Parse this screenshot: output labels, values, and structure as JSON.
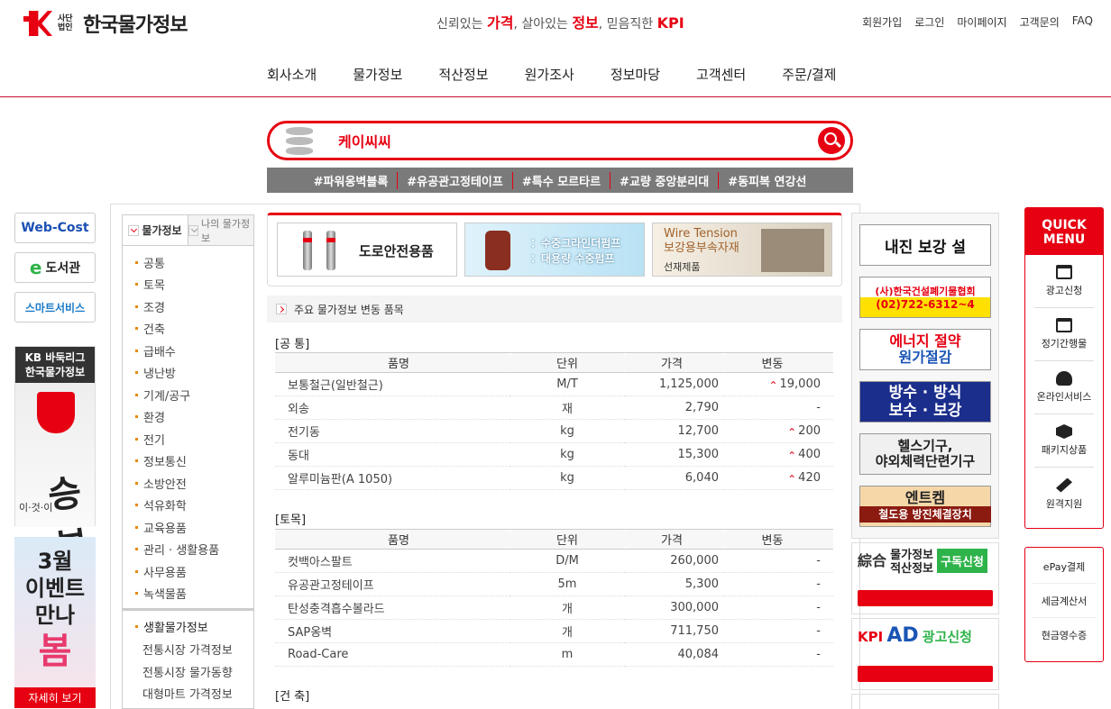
{
  "header": {
    "logo_sub": "사단법인",
    "logo_text": "한국물가정보",
    "slogan": {
      "p1": "신뢰있는 ",
      "b1": "가격",
      "p2": ", 살아있는 ",
      "b2": "정보",
      "p3": ", 믿음직한 ",
      "b3": "KPI"
    },
    "util": [
      "회원가입",
      "로그인",
      "마이페이지",
      "고객문의",
      "FAQ"
    ],
    "gnb": [
      "회사소개",
      "물가정보",
      "적산정보",
      "원가조사",
      "정보마당",
      "고객센터",
      "주문/결제"
    ]
  },
  "search": {
    "value": "케이씨씨",
    "placeholder": ""
  },
  "tags": [
    "#파워옹벽블록",
    "#유공관고정테이프",
    "#특수 모르타르",
    "#교량 중앙분리대",
    "#동피복 연강선"
  ],
  "side_left": {
    "webcost": "Web-Cost",
    "library": "도서관",
    "smart": "스마트서비스",
    "kb_title": "KB 바둑리그",
    "kb_title2": "한국물가정보",
    "kb_small": "이·것·이",
    "kb_calli": "승부다",
    "event_l1": "3월",
    "event_l2": "이벤트",
    "event_l3": "만나",
    "event_big": "봄",
    "event_more": "자세히 보기"
  },
  "lnb": {
    "tab_active": "물가정보",
    "tab_other": "나의 물가정보",
    "items": [
      "공통",
      "토목",
      "조경",
      "건축",
      "급배수",
      "냉난방",
      "기계/공구",
      "환경",
      "전기",
      "정보통신",
      "소방안전",
      "석유화학",
      "교육용품",
      "관리 · 생활용품",
      "사무용품",
      "녹색물품"
    ],
    "living_head": "생활물가정보",
    "living_items": [
      "전통시장 가격정보",
      "전통시장 물가동향",
      "대형마트 가격정보"
    ]
  },
  "banners": {
    "b1": "도로안전용품",
    "b2_l1": "：수중그라인더펌프",
    "b2_l2": "：대용량 수중펌프",
    "b3_l1": "Wire Tension",
    "b3_l2": "보강용부속자재",
    "b3_l3": "선재제품"
  },
  "section_title": "주요 물가정보 변동 품목",
  "table_headers": {
    "name": "품명",
    "unit": "단위",
    "price": "가격",
    "change": "변동"
  },
  "groups": [
    {
      "label": "[공 통]",
      "rows": [
        {
          "name": "보통철근(일반철근)",
          "unit": "M/T",
          "price": "1,125,000",
          "change": "19,000",
          "up": true
        },
        {
          "name": "외송",
          "unit": "재",
          "price": "2,790",
          "change": "-",
          "up": false
        },
        {
          "name": "전기동",
          "unit": "kg",
          "price": "12,700",
          "change": "200",
          "up": true
        },
        {
          "name": "동대",
          "unit": "kg",
          "price": "15,300",
          "change": "400",
          "up": true
        },
        {
          "name": "알루미늄판(A 1050)",
          "unit": "kg",
          "price": "6,040",
          "change": "420",
          "up": true
        }
      ]
    },
    {
      "label": "[토목]",
      "rows": [
        {
          "name": "컷백아스팔트",
          "unit": "D/M",
          "price": "260,000",
          "change": "-",
          "up": false
        },
        {
          "name": "유공관고정테이프",
          "unit": "5m",
          "price": "5,300",
          "change": "-",
          "up": false
        },
        {
          "name": "탄성충격흡수볼라드",
          "unit": "개",
          "price": "300,000",
          "change": "-",
          "up": false
        },
        {
          "name": "SAP옹벽",
          "unit": "개",
          "price": "711,750",
          "change": "-",
          "up": false
        },
        {
          "name": "Road-Care",
          "unit": "m",
          "price": "40,084",
          "change": "-",
          "up": false
        }
      ]
    },
    {
      "label": "[건 축]",
      "rows": []
    }
  ],
  "right_ads": {
    "ad1": "내진 보강 설",
    "ad2_l1": "(사)한국건설폐기물협회",
    "ad2_l2": "(02)722-6312~4",
    "ad3_l1": "에너지 절약",
    "ad3_l2": "원가절감",
    "ad4_l1": "방수 · 방식",
    "ad4_l2": "보수 · 보강",
    "ad5_l1": "헬스기구,",
    "ad5_l2": "야외체력단련기구",
    "ad6_l1": "엔트켐",
    "ad6_l2": "철도용 방진체결장치",
    "box1_l1": "綜合",
    "box1_l2": "물가정보",
    "box1_l3": "적산정보",
    "box1_sub": "구독신청",
    "box2_logo": "KPI",
    "box2_ad": "AD",
    "box2_sub": "광고신청"
  },
  "quick": {
    "title": "QUICK MENU",
    "items": [
      "광고신청",
      "정기간행물",
      "온라인서비스",
      "패키지상품",
      "원격지원"
    ],
    "items2": [
      "ePay결제",
      "세금계산서",
      "현금영수증"
    ]
  }
}
